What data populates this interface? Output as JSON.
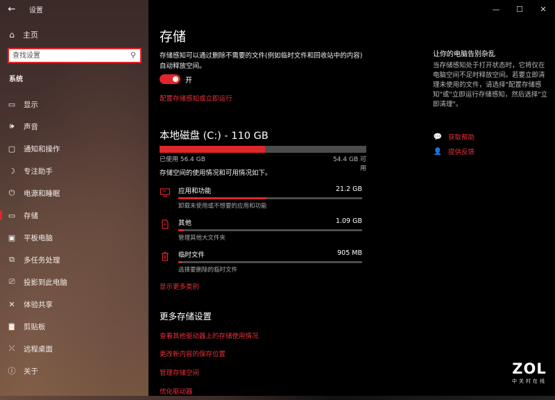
{
  "app": {
    "title": "设置",
    "back_glyph": "←"
  },
  "window": {
    "minimize": "—",
    "maximize": "☐",
    "close": "✕"
  },
  "sidebar": {
    "home_label": "主页",
    "search_placeholder": "查找设置",
    "section_label": "系统",
    "items": [
      {
        "label": "显示",
        "icon": "display-icon",
        "glyph": "▭"
      },
      {
        "label": "声音",
        "icon": "speaker-icon",
        "glyph": "🕪"
      },
      {
        "label": "通知和操作",
        "icon": "notification-icon",
        "glyph": "▢"
      },
      {
        "label": "专注助手",
        "icon": "moon-icon",
        "glyph": "☽"
      },
      {
        "label": "电源和睡眠",
        "icon": "power-icon",
        "glyph": "⏻"
      },
      {
        "label": "存储",
        "icon": "storage-icon",
        "glyph": "▭",
        "active": true
      },
      {
        "label": "平板电脑",
        "icon": "tablet-icon",
        "glyph": "▣"
      },
      {
        "label": "多任务处理",
        "icon": "multitask-icon",
        "glyph": "⧉"
      },
      {
        "label": "投影到此电脑",
        "icon": "project-icon",
        "glyph": "⎚"
      },
      {
        "label": "体验共享",
        "icon": "share-icon",
        "glyph": "✕"
      },
      {
        "label": "剪贴板",
        "icon": "clipboard-icon",
        "glyph": "📋"
      },
      {
        "label": "远程桌面",
        "icon": "remote-desktop-icon",
        "glyph": "⤫"
      },
      {
        "label": "关于",
        "icon": "info-icon",
        "glyph": "ⓘ"
      }
    ]
  },
  "main": {
    "title": "存储",
    "sense_desc": "存储感知可以通过删除不需要的文件(例如临时文件和回收站中的内容)自动释放空间。",
    "toggle_label": "开",
    "toggle_on": true,
    "config_link": "配置存储感知或立即运行",
    "disk": {
      "title": "本地磁盘 (C:) - 110 GB",
      "used": "已使用 56.4 GB",
      "free": "54.4 GB 可用",
      "used_fraction": 0.51,
      "desc": "存储空间的使用情况和可用情况如下。"
    },
    "categories": [
      {
        "name": "应用和功能",
        "size": "21.2 GB",
        "desc": "卸载未使用或不想要的应用和功能",
        "fraction": 0.48,
        "icon": "apps-icon"
      },
      {
        "name": "其他",
        "size": "1.09 GB",
        "desc": "管理其他大文件夹",
        "fraction": 0.03,
        "icon": "folder-icon"
      },
      {
        "name": "临时文件",
        "size": "905 MB",
        "desc": "选择要删除的临时文件",
        "fraction": 0.02,
        "icon": "trash-icon"
      }
    ],
    "show_more": "显示更多类别",
    "more_settings_title": "更多存储设置",
    "more_links": [
      "查看其他驱动器上的存储使用情况",
      "更改新内容的保存位置",
      "管理存储空间",
      "优化驱动器"
    ]
  },
  "right_panel": {
    "title": "让你的电脑告别杂乱",
    "desc": "当存储感知处于打开状态时，它将仅在电脑空间不足时释放空间。若要立即清理未使用的文件，请选择\"配置存储感知\"或\"立即运行存储感知，然后选择\"立即清理\"。",
    "help_link": "获取帮助",
    "feedback_link": "提供反馈"
  },
  "watermark": {
    "main": "ZOL",
    "sub": "中关村在线"
  },
  "colors": {
    "accent": "#e0262b",
    "link": "#e8323a"
  }
}
